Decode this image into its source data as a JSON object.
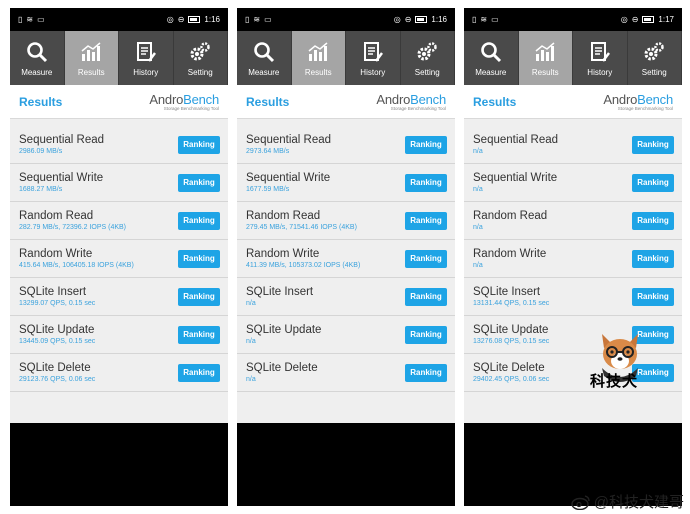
{
  "phones": [
    {
      "status_time": "1:16",
      "tabs": [
        "Measure",
        "Results",
        "History",
        "Setting"
      ],
      "results_label": "Results",
      "logo_andro": "Andro",
      "logo_bench": "Bench",
      "logo_sub": "Storage Benchmarking Tool",
      "rows": [
        {
          "name": "Sequential Read",
          "value": "2986.09 MB/s",
          "button": "Ranking"
        },
        {
          "name": "Sequential Write",
          "value": "1688.27 MB/s",
          "button": "Ranking"
        },
        {
          "name": "Random Read",
          "value": "282.79 MB/s, 72396.2 IOPS (4KB)",
          "button": "Ranking"
        },
        {
          "name": "Random Write",
          "value": "415.64 MB/s, 106405.18 IOPS (4KB)",
          "button": "Ranking"
        },
        {
          "name": "SQLite Insert",
          "value": "13299.07 QPS, 0.15 sec",
          "button": "Ranking"
        },
        {
          "name": "SQLite Update",
          "value": "13445.09 QPS, 0.15 sec",
          "button": "Ranking"
        },
        {
          "name": "SQLite Delete",
          "value": "29123.76 QPS, 0.06 sec",
          "button": "Ranking"
        }
      ]
    },
    {
      "status_time": "1:16",
      "tabs": [
        "Measure",
        "Results",
        "History",
        "Setting"
      ],
      "results_label": "Results",
      "logo_andro": "Andro",
      "logo_bench": "Bench",
      "logo_sub": "Storage Benchmarking Tool",
      "rows": [
        {
          "name": "Sequential Read",
          "value": "2973.64 MB/s",
          "button": "Ranking"
        },
        {
          "name": "Sequential Write",
          "value": "1677.59 MB/s",
          "button": "Ranking"
        },
        {
          "name": "Random Read",
          "value": "279.45 MB/s, 71541.46 IOPS (4KB)",
          "button": "Ranking"
        },
        {
          "name": "Random Write",
          "value": "411.39 MB/s, 105373.02 IOPS (4KB)",
          "button": "Ranking"
        },
        {
          "name": "SQLite Insert",
          "value": "n/a",
          "button": "Ranking"
        },
        {
          "name": "SQLite Update",
          "value": "n/a",
          "button": "Ranking"
        },
        {
          "name": "SQLite Delete",
          "value": "n/a",
          "button": "Ranking"
        }
      ]
    },
    {
      "status_time": "1:17",
      "tabs": [
        "Measure",
        "Results",
        "History",
        "Setting"
      ],
      "results_label": "Results",
      "logo_andro": "Andro",
      "logo_bench": "Bench",
      "logo_sub": "Storage Benchmarking Tool",
      "rows": [
        {
          "name": "Sequential Read",
          "value": "n/a",
          "button": "Ranking"
        },
        {
          "name": "Sequential Write",
          "value": "n/a",
          "button": "Ranking"
        },
        {
          "name": "Random Read",
          "value": "n/a",
          "button": "Ranking"
        },
        {
          "name": "Random Write",
          "value": "n/a",
          "button": "Ranking"
        },
        {
          "name": "SQLite Insert",
          "value": "13131.44 QPS, 0.15 sec",
          "button": "Ranking"
        },
        {
          "name": "SQLite Update",
          "value": "13276.08 QPS, 0.15 sec",
          "button": "Ranking"
        },
        {
          "name": "SQLite Delete",
          "value": "29402.45 QPS, 0.06 sec",
          "button": "Ranking"
        }
      ]
    }
  ],
  "mascot_text": "科技犬",
  "watermark": "@科技犬建哥",
  "colors": {
    "accent": "#1ea4e6",
    "tab_bg": "#4a4a4a",
    "tab_active": "#a5a5a5"
  }
}
